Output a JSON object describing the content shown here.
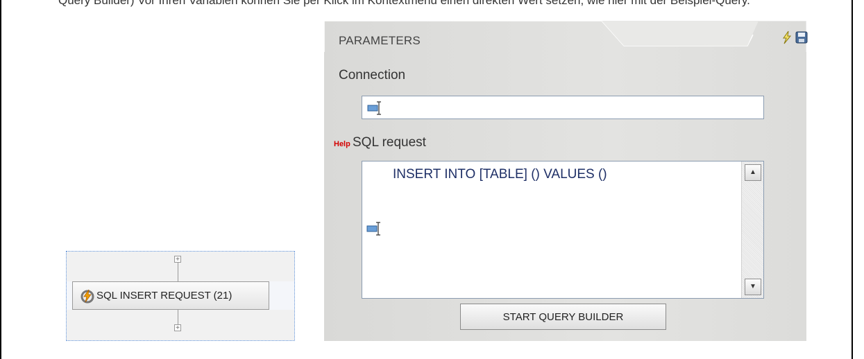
{
  "top_text": "Query Builder) Vor Ihren Variablen können Sie per Klick im Kontextmenü einen direkten Wert setzen, wie hier mit der Beispiel-Query.",
  "node": {
    "label": "SQL INSERT REQUEST (21)",
    "icon": "sql-lightning-icon"
  },
  "panel": {
    "title": "PARAMETERS",
    "icons": [
      "lightning-icon",
      "save-icon"
    ],
    "connection_label": "Connection",
    "connection_value": "",
    "help_label": "Help",
    "sql_label": "SQL request",
    "sql_value": "INSERT INTO [TABLE] () VALUES ()",
    "scroll_up": "▲",
    "scroll_down": "▼",
    "query_builder_button": "START QUERY BUILDER"
  },
  "colors": {
    "help": "#d40000",
    "sql_text": "#1e2f66",
    "panel_bg": "#dddddb"
  }
}
